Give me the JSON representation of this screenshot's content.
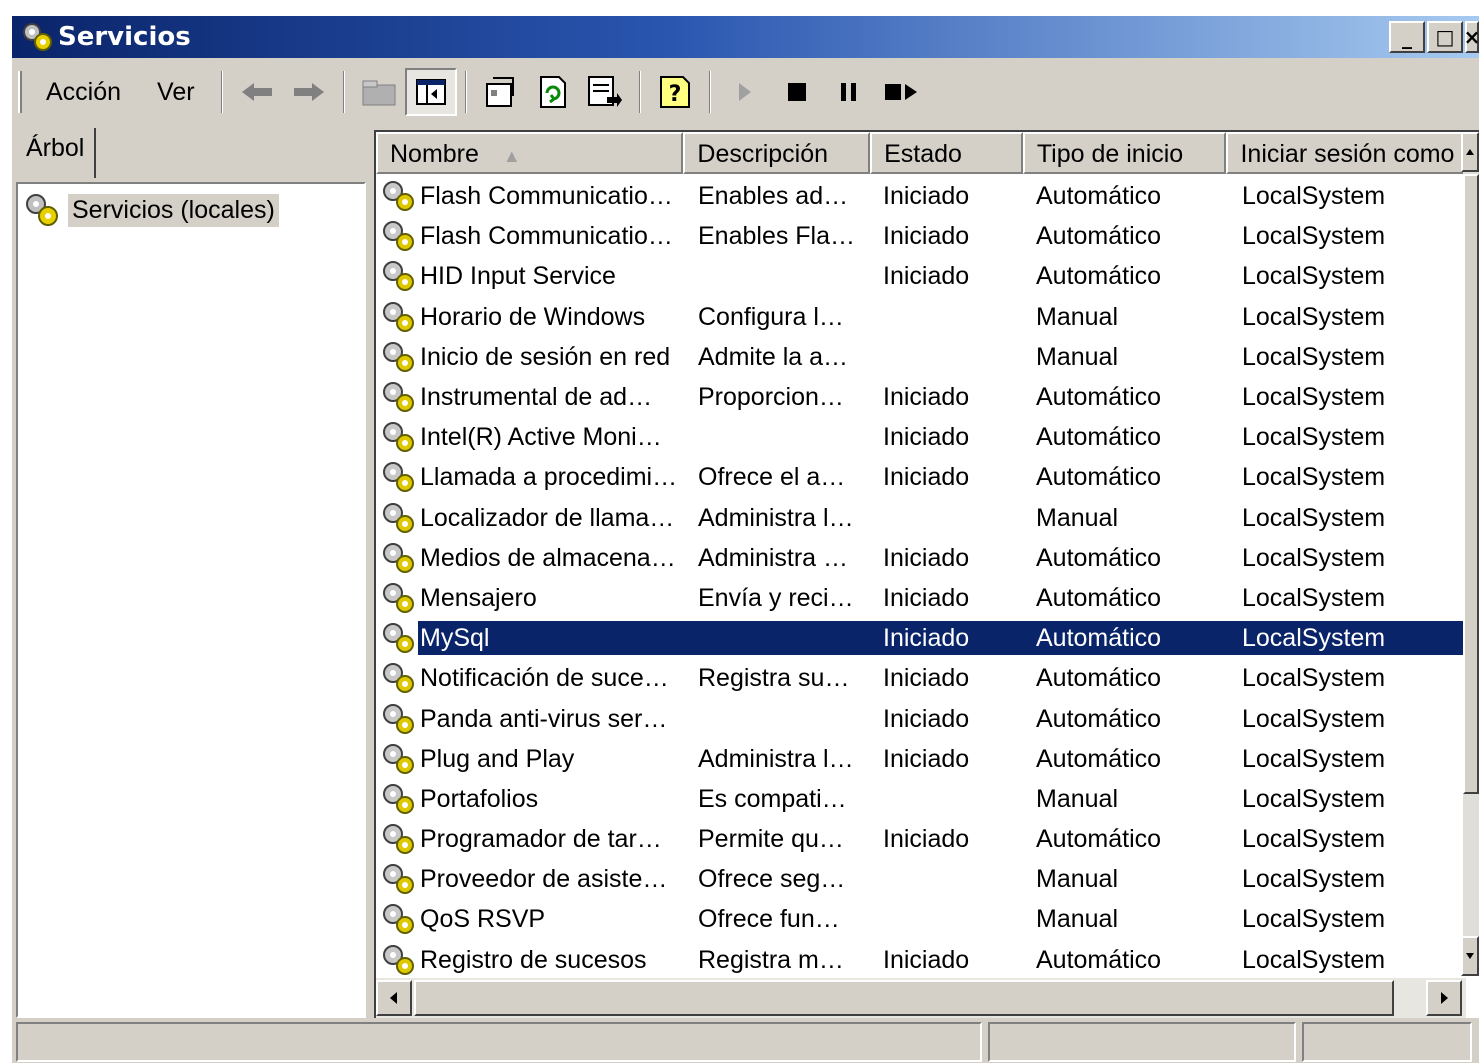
{
  "window": {
    "title": "Servicios",
    "controls": {
      "minimize": "_",
      "maximize": "□",
      "close": "×"
    }
  },
  "menu": {
    "action": "Acción",
    "view": "Ver"
  },
  "toolbar_icons": [
    "back-arrow-icon",
    "forward-arrow-icon",
    "up-folder-icon",
    "show-hide-tree-icon",
    "properties-icon",
    "refresh-icon",
    "export-list-icon",
    "help-icon",
    "start-service-icon",
    "stop-service-icon",
    "pause-service-icon",
    "restart-service-icon"
  ],
  "left": {
    "tab_label": "Árbol",
    "tree_root": "Servicios (locales)"
  },
  "columns": {
    "name": "Nombre",
    "description": "Descripción",
    "state": "Estado",
    "startup": "Tipo de inicio",
    "logon": "Iniciar sesión como"
  },
  "services": [
    {
      "name": "Flash Communicatio…",
      "description": "Enables ad…",
      "state": "Iniciado",
      "startup": "Automático",
      "logon": "LocalSystem"
    },
    {
      "name": "Flash Communicatio…",
      "description": "Enables Fla…",
      "state": "Iniciado",
      "startup": "Automático",
      "logon": "LocalSystem"
    },
    {
      "name": "HID Input Service",
      "description": "",
      "state": "Iniciado",
      "startup": "Automático",
      "logon": "LocalSystem"
    },
    {
      "name": "Horario de Windows",
      "description": "Configura l…",
      "state": "",
      "startup": "Manual",
      "logon": "LocalSystem"
    },
    {
      "name": "Inicio de sesión en red",
      "description": "Admite la a…",
      "state": "",
      "startup": "Manual",
      "logon": "LocalSystem"
    },
    {
      "name": "Instrumental de ad…",
      "description": "Proporcion…",
      "state": "Iniciado",
      "startup": "Automático",
      "logon": "LocalSystem"
    },
    {
      "name": "Intel(R) Active Moni…",
      "description": "",
      "state": "Iniciado",
      "startup": "Automático",
      "logon": "LocalSystem"
    },
    {
      "name": "Llamada a procedimi…",
      "description": "Ofrece el a…",
      "state": "Iniciado",
      "startup": "Automático",
      "logon": "LocalSystem"
    },
    {
      "name": "Localizador de llama…",
      "description": "Administra l…",
      "state": "",
      "startup": "Manual",
      "logon": "LocalSystem"
    },
    {
      "name": "Medios de almacena…",
      "description": "Administra …",
      "state": "Iniciado",
      "startup": "Automático",
      "logon": "LocalSystem"
    },
    {
      "name": "Mensajero",
      "description": "Envía y reci…",
      "state": "Iniciado",
      "startup": "Automático",
      "logon": "LocalSystem"
    },
    {
      "name": "MySql",
      "description": "",
      "state": "Iniciado",
      "startup": "Automático",
      "logon": "LocalSystem",
      "selected": true
    },
    {
      "name": "Notificación de suce…",
      "description": "Registra su…",
      "state": "Iniciado",
      "startup": "Automático",
      "logon": "LocalSystem"
    },
    {
      "name": "Panda anti-virus ser…",
      "description": "",
      "state": "Iniciado",
      "startup": "Automático",
      "logon": "LocalSystem"
    },
    {
      "name": "Plug and Play",
      "description": "Administra l…",
      "state": "Iniciado",
      "startup": "Automático",
      "logon": "LocalSystem"
    },
    {
      "name": "Portafolios",
      "description": "Es compati…",
      "state": "",
      "startup": "Manual",
      "logon": "LocalSystem"
    },
    {
      "name": "Programador de tar…",
      "description": "Permite qu…",
      "state": "Iniciado",
      "startup": "Automático",
      "logon": "LocalSystem"
    },
    {
      "name": "Proveedor de asiste…",
      "description": "Ofrece seg…",
      "state": "",
      "startup": "Manual",
      "logon": "LocalSystem"
    },
    {
      "name": "QoS RSVP",
      "description": "Ofrece fun…",
      "state": "",
      "startup": "Manual",
      "logon": "LocalSystem"
    },
    {
      "name": "Registro de sucesos",
      "description": "Registra m…",
      "state": "Iniciado",
      "startup": "Automático",
      "logon": "LocalSystem"
    }
  ],
  "colors": {
    "title_start": "#0a246a",
    "title_end": "#a6caf0",
    "selection": "#0a246a",
    "face": "#d4d0c8"
  }
}
